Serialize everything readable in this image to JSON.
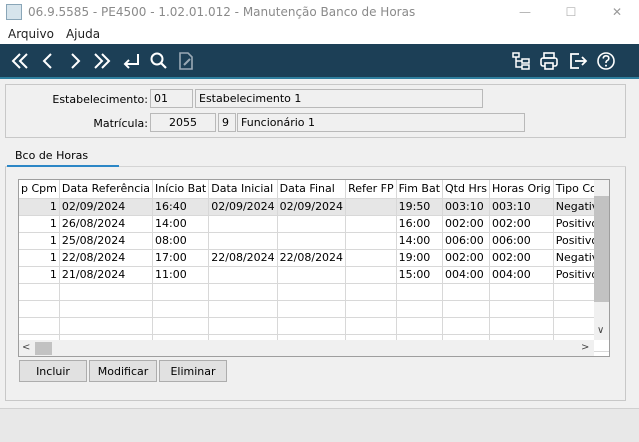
{
  "window": {
    "title": "06.9.5585 - PE4500 - 1.02.01.012 - Manutenção Banco de Horas",
    "minimize": "—",
    "maximize": "☐",
    "close": "✕"
  },
  "menu": {
    "items": [
      "Arquivo",
      "Ajuda"
    ]
  },
  "toolbar": {
    "icons": [
      "first-icon",
      "previous-icon",
      "next-icon",
      "last-icon",
      "goto-icon",
      "search-icon",
      "edit-document-icon",
      "structure-icon",
      "print-icon",
      "exit-icon",
      "help-icon"
    ],
    "colors": {
      "background": "#1c3f56",
      "accent": "#2f7f9e"
    }
  },
  "header": {
    "estabelecimento_label": "Estabelecimento:",
    "estabelecimento_code": "01",
    "estabelecimento_name": "Estabelecimento 1",
    "matricula_label": "Matrícula:",
    "matricula_code": "2055",
    "matricula_digit": "9",
    "matricula_name": "Funcionário 1"
  },
  "tabs": [
    {
      "label": "Bco de Horas",
      "active": true
    }
  ],
  "grid": {
    "columns": [
      "p Cpm",
      "Data Referência",
      "Início Bat",
      "Data Inicial",
      "Data Final",
      "Refer FP",
      "Fim Bat",
      "Qtd Hrs",
      "Horas Orig",
      "Tipo Compe"
    ],
    "rows": [
      [
        "1",
        "02/09/2024",
        "16:40",
        "02/09/2024",
        "02/09/2024",
        "",
        "19:50",
        "003:10",
        "003:10",
        "Negativo"
      ],
      [
        "1",
        "26/08/2024",
        "14:00",
        "",
        "",
        "",
        "16:00",
        "002:00",
        "002:00",
        "Positivo"
      ],
      [
        "1",
        "25/08/2024",
        "08:00",
        "",
        "",
        "",
        "14:00",
        "006:00",
        "006:00",
        "Positivo"
      ],
      [
        "1",
        "22/08/2024",
        "17:00",
        "22/08/2024",
        "22/08/2024",
        "",
        "19:00",
        "002:00",
        "002:00",
        "Negativo"
      ],
      [
        "1",
        "21/08/2024",
        "11:00",
        "",
        "",
        "",
        "15:00",
        "004:00",
        "004:00",
        "Positivo"
      ]
    ],
    "selected_row": 0
  },
  "buttons": {
    "incluir": "Incluir",
    "modificar": "Modificar",
    "eliminar": "Eliminar"
  }
}
